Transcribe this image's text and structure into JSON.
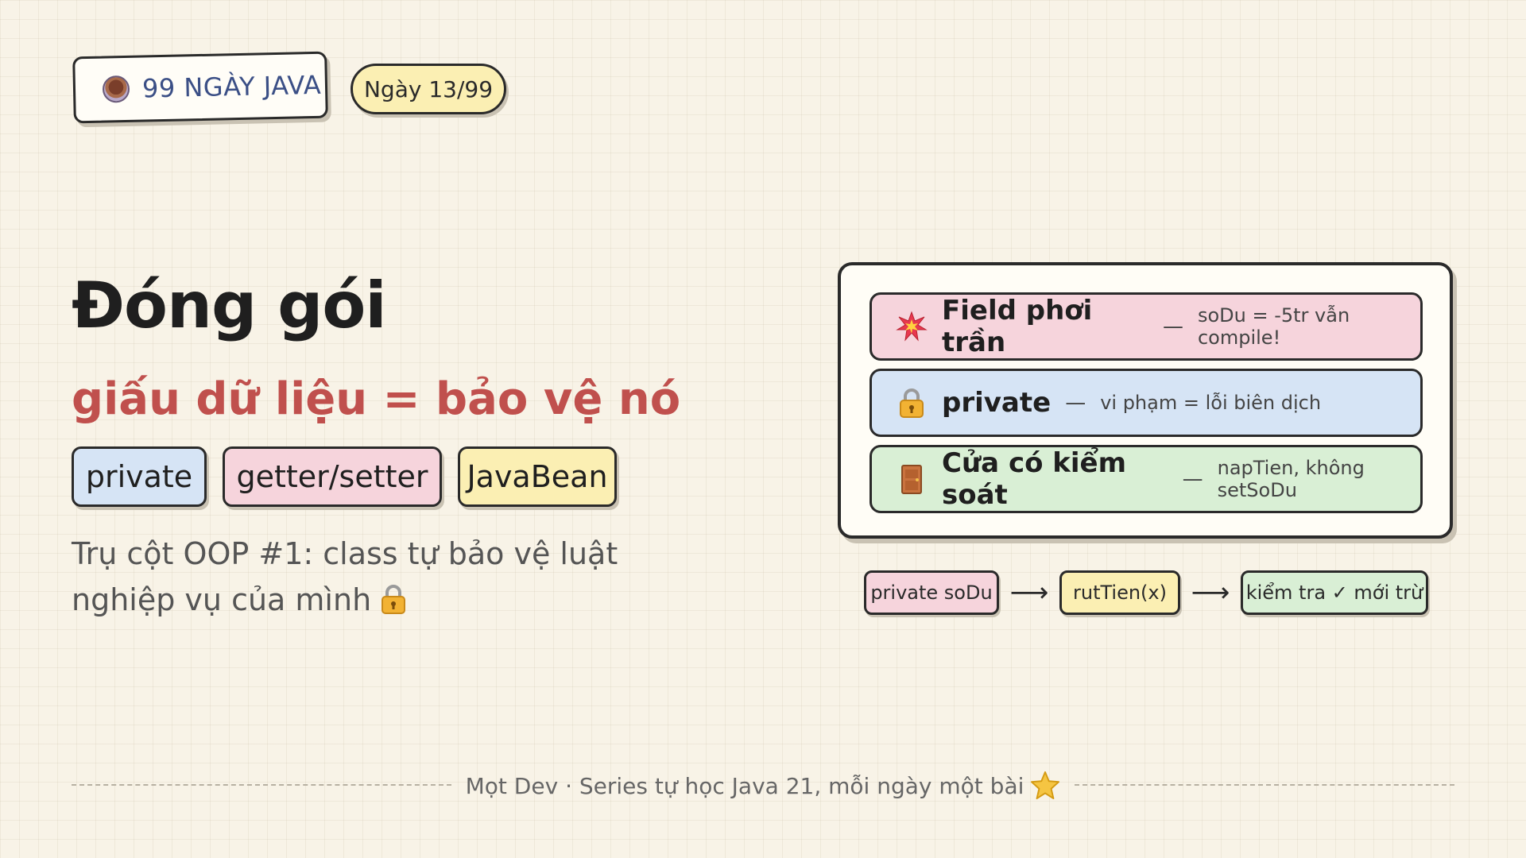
{
  "header": {
    "series_badge": {
      "icon": "coffee-cup-icon",
      "label": "99 NGÀY JAVA"
    },
    "day_badge": "Ngày 13/99"
  },
  "hero": {
    "title": "Đóng gói",
    "subtitle": "giấu dữ liệu = bảo vệ nó",
    "tags": [
      "private",
      "getter/setter",
      "JavaBean"
    ],
    "description": "Trụ cột OOP #1: class tự bảo vệ luật nghiệp vụ của mình",
    "description_icon": "lock-icon"
  },
  "card": {
    "rows": [
      {
        "icon": "explosion-icon",
        "title": "Field phơi trần",
        "separator": "—",
        "note": "soDu = -5tr vẫn compile!"
      },
      {
        "icon": "lock-icon",
        "title": "private",
        "separator": "—",
        "note": "vi phạm = lỗi biên dịch"
      },
      {
        "icon": "door-icon",
        "title": "Cửa có kiểm soát",
        "separator": "—",
        "note": "napTien, không setSoDu"
      }
    ]
  },
  "flow": {
    "steps": [
      "private soDu",
      "rutTien(x)",
      "kiểm tra ✓ mới trừ"
    ],
    "arrow": "⟶"
  },
  "footer": {
    "text": "Mọt Dev · Series tự học Java 21, mỗi ngày một bài",
    "icon": "star-icon"
  },
  "colors": {
    "background": "#f8f3e7",
    "accent_red": "#c0504d",
    "series_blue": "#3b4f86",
    "pink": "#f6d4dc",
    "blue": "#d6e4f5",
    "yellow": "#fbefb3",
    "green": "#d9efd5"
  }
}
